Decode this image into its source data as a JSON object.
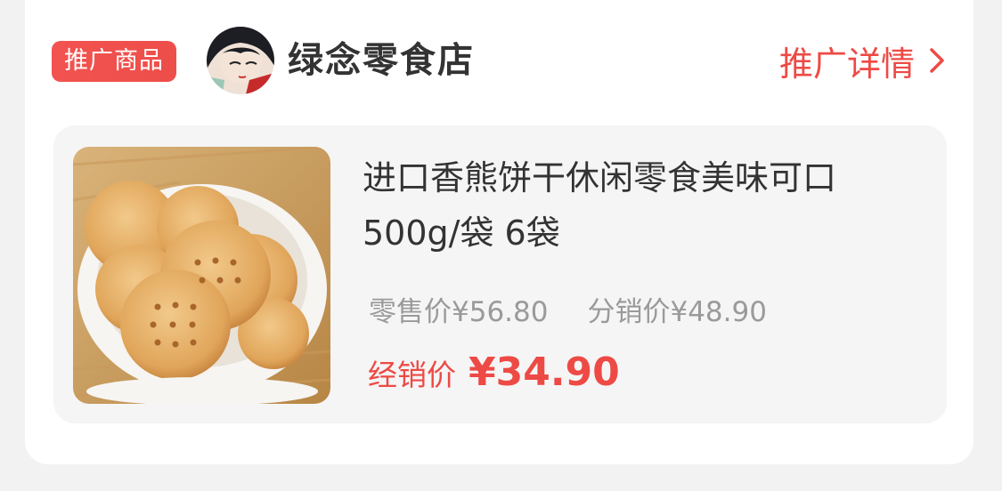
{
  "header": {
    "badge": "推广商品",
    "shop_name": "绿念零食店",
    "promo_details": "推广详情"
  },
  "product": {
    "title": "进口香熊饼干休闲零食美味可口500g/袋 6袋",
    "retail_price": "零售价¥56.80",
    "distribution_price": "分销价¥48.90",
    "dealer_label": "经销价",
    "dealer_price": "¥34.90"
  },
  "icons": {
    "chevron": "chevron-right-icon",
    "avatar": "avatar-image"
  },
  "colors": {
    "accent": "#ee4a45",
    "muted": "#9a9a9a",
    "text": "#333333"
  }
}
